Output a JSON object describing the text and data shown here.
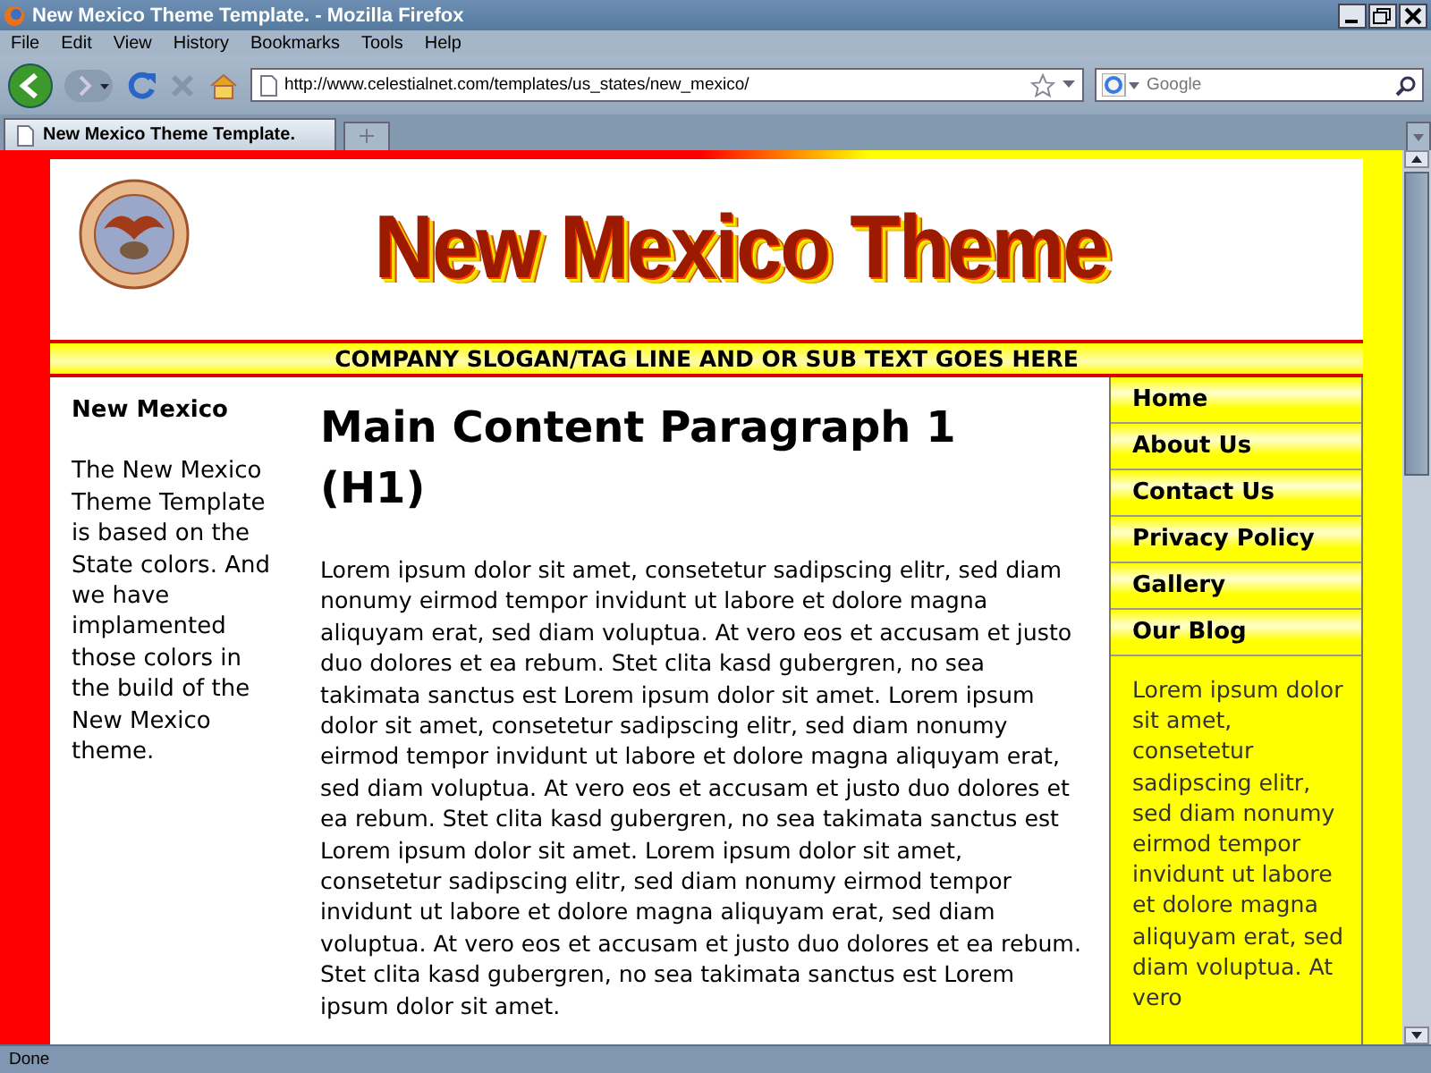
{
  "window": {
    "title": "New Mexico Theme Template. - Mozilla Firefox"
  },
  "menu": [
    "File",
    "Edit",
    "View",
    "History",
    "Bookmarks",
    "Tools",
    "Help"
  ],
  "address_bar": {
    "value": "http://www.celestialnet.com/templates/us_states/new_mexico/"
  },
  "search": {
    "placeholder": "Google"
  },
  "tabs": [
    {
      "label": "New Mexico Theme Template.",
      "selected": true
    }
  ],
  "page": {
    "logo": "New Mexico Theme",
    "slogan": "COMPANY SLOGAN/TAG LINE AND OR SUB TEXT GOES HERE",
    "left_sidebar": {
      "title": "New Mexico",
      "text": "The New Mexico Theme Template is based on the State colors. And we have implamented those colors in the build of the New Mexico theme."
    },
    "main": {
      "heading": "Main Content Paragraph 1 (H1)",
      "text": "Lorem ipsum dolor sit amet, consetetur sadipscing elitr, sed diam nonumy eirmod tempor invidunt ut labore et dolore magna aliquyam erat, sed diam voluptua. At vero eos et accusam et justo duo dolores et ea rebum. Stet clita kasd gubergren, no sea takimata sanctus est Lorem ipsum dolor sit amet. Lorem ipsum dolor sit amet, consetetur sadipscing elitr, sed diam nonumy eirmod tempor invidunt ut labore et dolore magna aliquyam erat, sed diam voluptua. At vero eos et accusam et justo duo dolores et ea rebum. Stet clita kasd gubergren, no sea takimata sanctus est Lorem ipsum dolor sit amet. Lorem ipsum dolor sit amet, consetetur sadipscing elitr, sed diam nonumy eirmod tempor invidunt ut labore et dolore magna aliquyam erat, sed diam voluptua. At vero eos et accusam et justo duo dolores et ea rebum. Stet clita kasd gubergren, no sea takimata sanctus est Lorem ipsum dolor sit amet."
    },
    "nav": [
      "Home",
      "About Us",
      "Contact Us",
      "Privacy Policy",
      "Gallery",
      "Our Blog"
    ],
    "right_text": "Lorem ipsum dolor sit amet, consetetur sadipscing elitr, sed diam nonumy eirmod tempor invidunt ut labore et dolore magna aliquyam erat, sed diam voluptua. At vero"
  },
  "status_bar": "Done"
}
